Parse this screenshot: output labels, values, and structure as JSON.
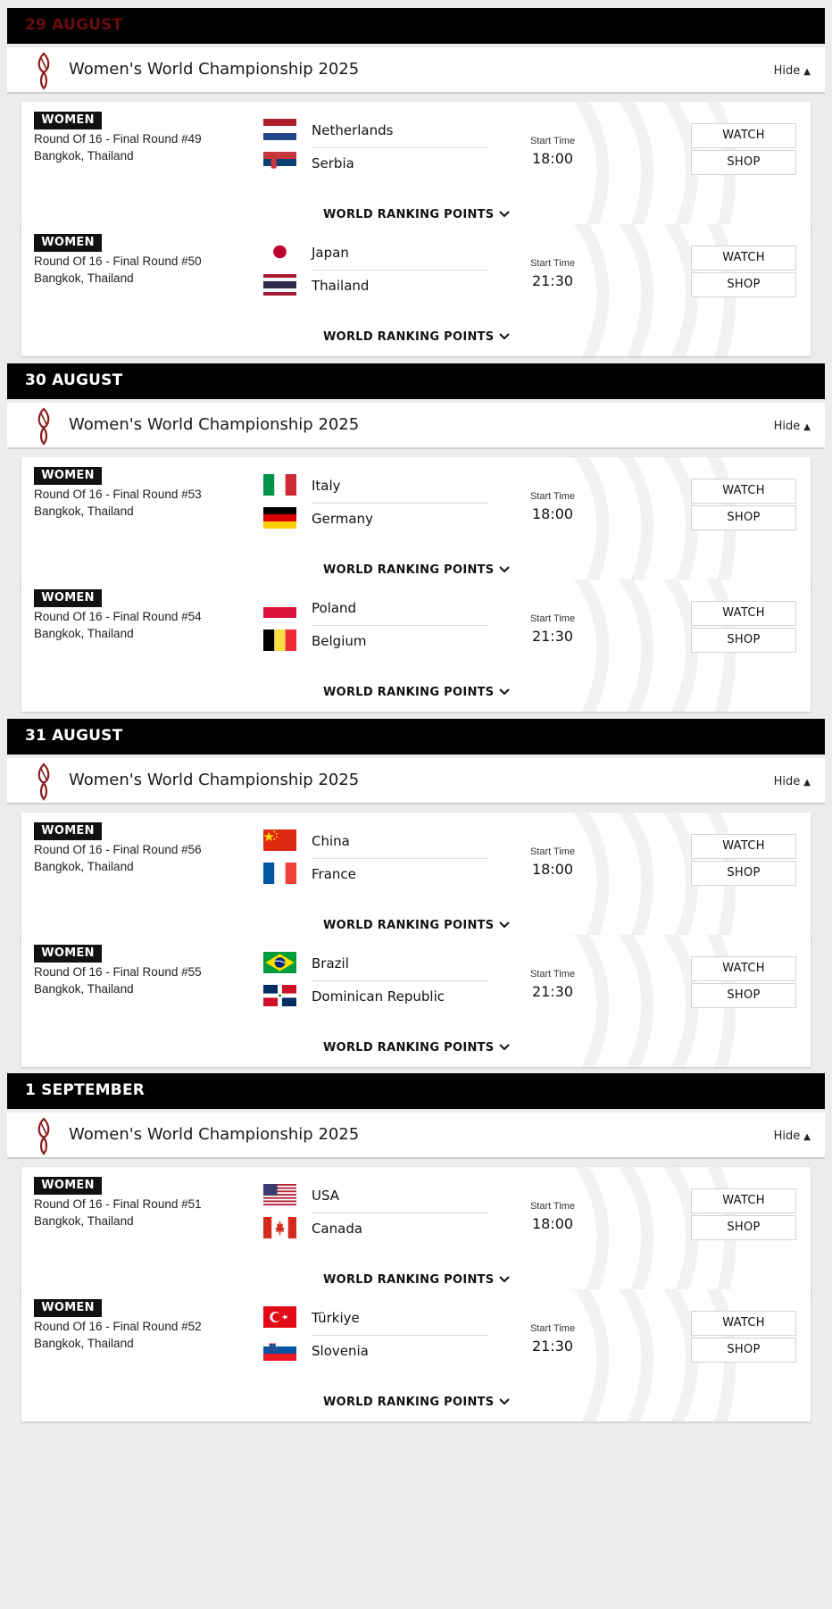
{
  "days": [
    {
      "label": "29 AUGUST",
      "competition": "Women's World Championship 2025",
      "hide_label": "Hide",
      "matches": [
        {
          "badge": "WOMEN",
          "round": "Round Of 16 - Final Round #49",
          "venue": "Bangkok, Thailand",
          "team1": "Netherlands",
          "team2": "Serbia",
          "flag1": "netherlands",
          "flag2": "serbia",
          "start_label": "Start Time",
          "time": "18:00",
          "watch": "WATCH",
          "shop": "SHOP",
          "wrp": "WORLD RANKING POINTS"
        },
        {
          "badge": "WOMEN",
          "round": "Round Of 16 - Final Round #50",
          "venue": "Bangkok, Thailand",
          "team1": "Japan",
          "team2": "Thailand",
          "flag1": "japan",
          "flag2": "thailand",
          "start_label": "Start Time",
          "time": "21:30",
          "watch": "WATCH",
          "shop": "SHOP",
          "wrp": "WORLD RANKING POINTS"
        }
      ]
    },
    {
      "label": "30 AUGUST",
      "competition": "Women's World Championship 2025",
      "hide_label": "Hide",
      "matches": [
        {
          "badge": "WOMEN",
          "round": "Round Of 16 - Final Round #53",
          "venue": "Bangkok, Thailand",
          "team1": "Italy",
          "team2": "Germany",
          "flag1": "italy",
          "flag2": "germany",
          "start_label": "Start Time",
          "time": "18:00",
          "watch": "WATCH",
          "shop": "SHOP",
          "wrp": "WORLD RANKING POINTS"
        },
        {
          "badge": "WOMEN",
          "round": "Round Of 16 - Final Round #54",
          "venue": "Bangkok, Thailand",
          "team1": "Poland",
          "team2": "Belgium",
          "flag1": "poland",
          "flag2": "belgium",
          "start_label": "Start Time",
          "time": "21:30",
          "watch": "WATCH",
          "shop": "SHOP",
          "wrp": "WORLD RANKING POINTS"
        }
      ]
    },
    {
      "label": "31 AUGUST",
      "competition": "Women's World Championship 2025",
      "hide_label": "Hide",
      "matches": [
        {
          "badge": "WOMEN",
          "round": "Round Of 16 - Final Round #56",
          "venue": "Bangkok, Thailand",
          "team1": "China",
          "team2": "France",
          "flag1": "china",
          "flag2": "france",
          "start_label": "Start Time",
          "time": "18:00",
          "watch": "WATCH",
          "shop": "SHOP",
          "wrp": "WORLD RANKING POINTS"
        },
        {
          "badge": "WOMEN",
          "round": "Round Of 16 - Final Round #55",
          "venue": "Bangkok, Thailand",
          "team1": "Brazil",
          "team2": "Dominican Republic",
          "flag1": "brazil",
          "flag2": "dominican-republic",
          "start_label": "Start Time",
          "time": "21:30",
          "watch": "WATCH",
          "shop": "SHOP",
          "wrp": "WORLD RANKING POINTS"
        }
      ]
    },
    {
      "label": "1 SEPTEMBER",
      "competition": "Women's World Championship 2025",
      "hide_label": "Hide",
      "matches": [
        {
          "badge": "WOMEN",
          "round": "Round Of 16 - Final Round #51",
          "venue": "Bangkok, Thailand",
          "team1": "USA",
          "team2": "Canada",
          "flag1": "usa",
          "flag2": "canada",
          "start_label": "Start Time",
          "time": "18:00",
          "watch": "WATCH",
          "shop": "SHOP",
          "wrp": "WORLD RANKING POINTS"
        },
        {
          "badge": "WOMEN",
          "round": "Round Of 16 - Final Round #52",
          "venue": "Bangkok, Thailand",
          "team1": "Türkiye",
          "team2": "Slovenia",
          "flag1": "turkiye",
          "flag2": "slovenia",
          "start_label": "Start Time",
          "time": "21:30",
          "watch": "WATCH",
          "shop": "SHOP",
          "wrp": "WORLD RANKING POINTS"
        }
      ]
    }
  ],
  "icons": {
    "logo": "volleyball-federation-logo-icon",
    "chevron_up": "chevron-up-icon",
    "chevron_down": "chevron-down-icon",
    "watermark": "volleyball-watermark-icon"
  },
  "colors": {
    "day_bar": "#000000",
    "badge": "#111111",
    "logo": "#8c1c1c"
  }
}
